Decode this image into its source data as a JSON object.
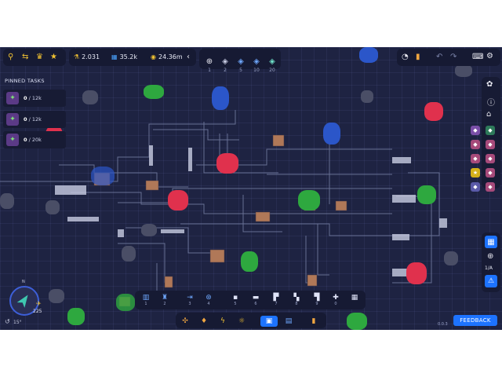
{
  "top_bar": {
    "research": "2.031",
    "shapes": "35.2k",
    "coins": "24.36m",
    "layer_slots": [
      "1",
      "2",
      "5",
      "10",
      "20"
    ]
  },
  "pinned": {
    "title": "PINNED TASKS",
    "tasks": [
      {
        "done": "0",
        "total": "/ 12k"
      },
      {
        "done": "0",
        "total": "/ 12k"
      },
      {
        "done": "0",
        "total": "/ 20k"
      }
    ]
  },
  "compass": {
    "north": "N",
    "value": "225",
    "angle": "15°"
  },
  "toolbar": {
    "slots": [
      "1",
      "2",
      "3",
      "4",
      "5",
      "6",
      "7",
      "8",
      "9",
      "0"
    ]
  },
  "right_panel": {
    "layer": "1/A"
  },
  "feedback_label": "FEEDBACK",
  "version": "0.0.3",
  "colors": {
    "background": "#1e2342",
    "panel": "#161a33",
    "accent_blue": "#1d73ff",
    "resource_red": "#e0314d",
    "resource_green": "#2ea83f",
    "resource_blue": "#2b56c9"
  }
}
